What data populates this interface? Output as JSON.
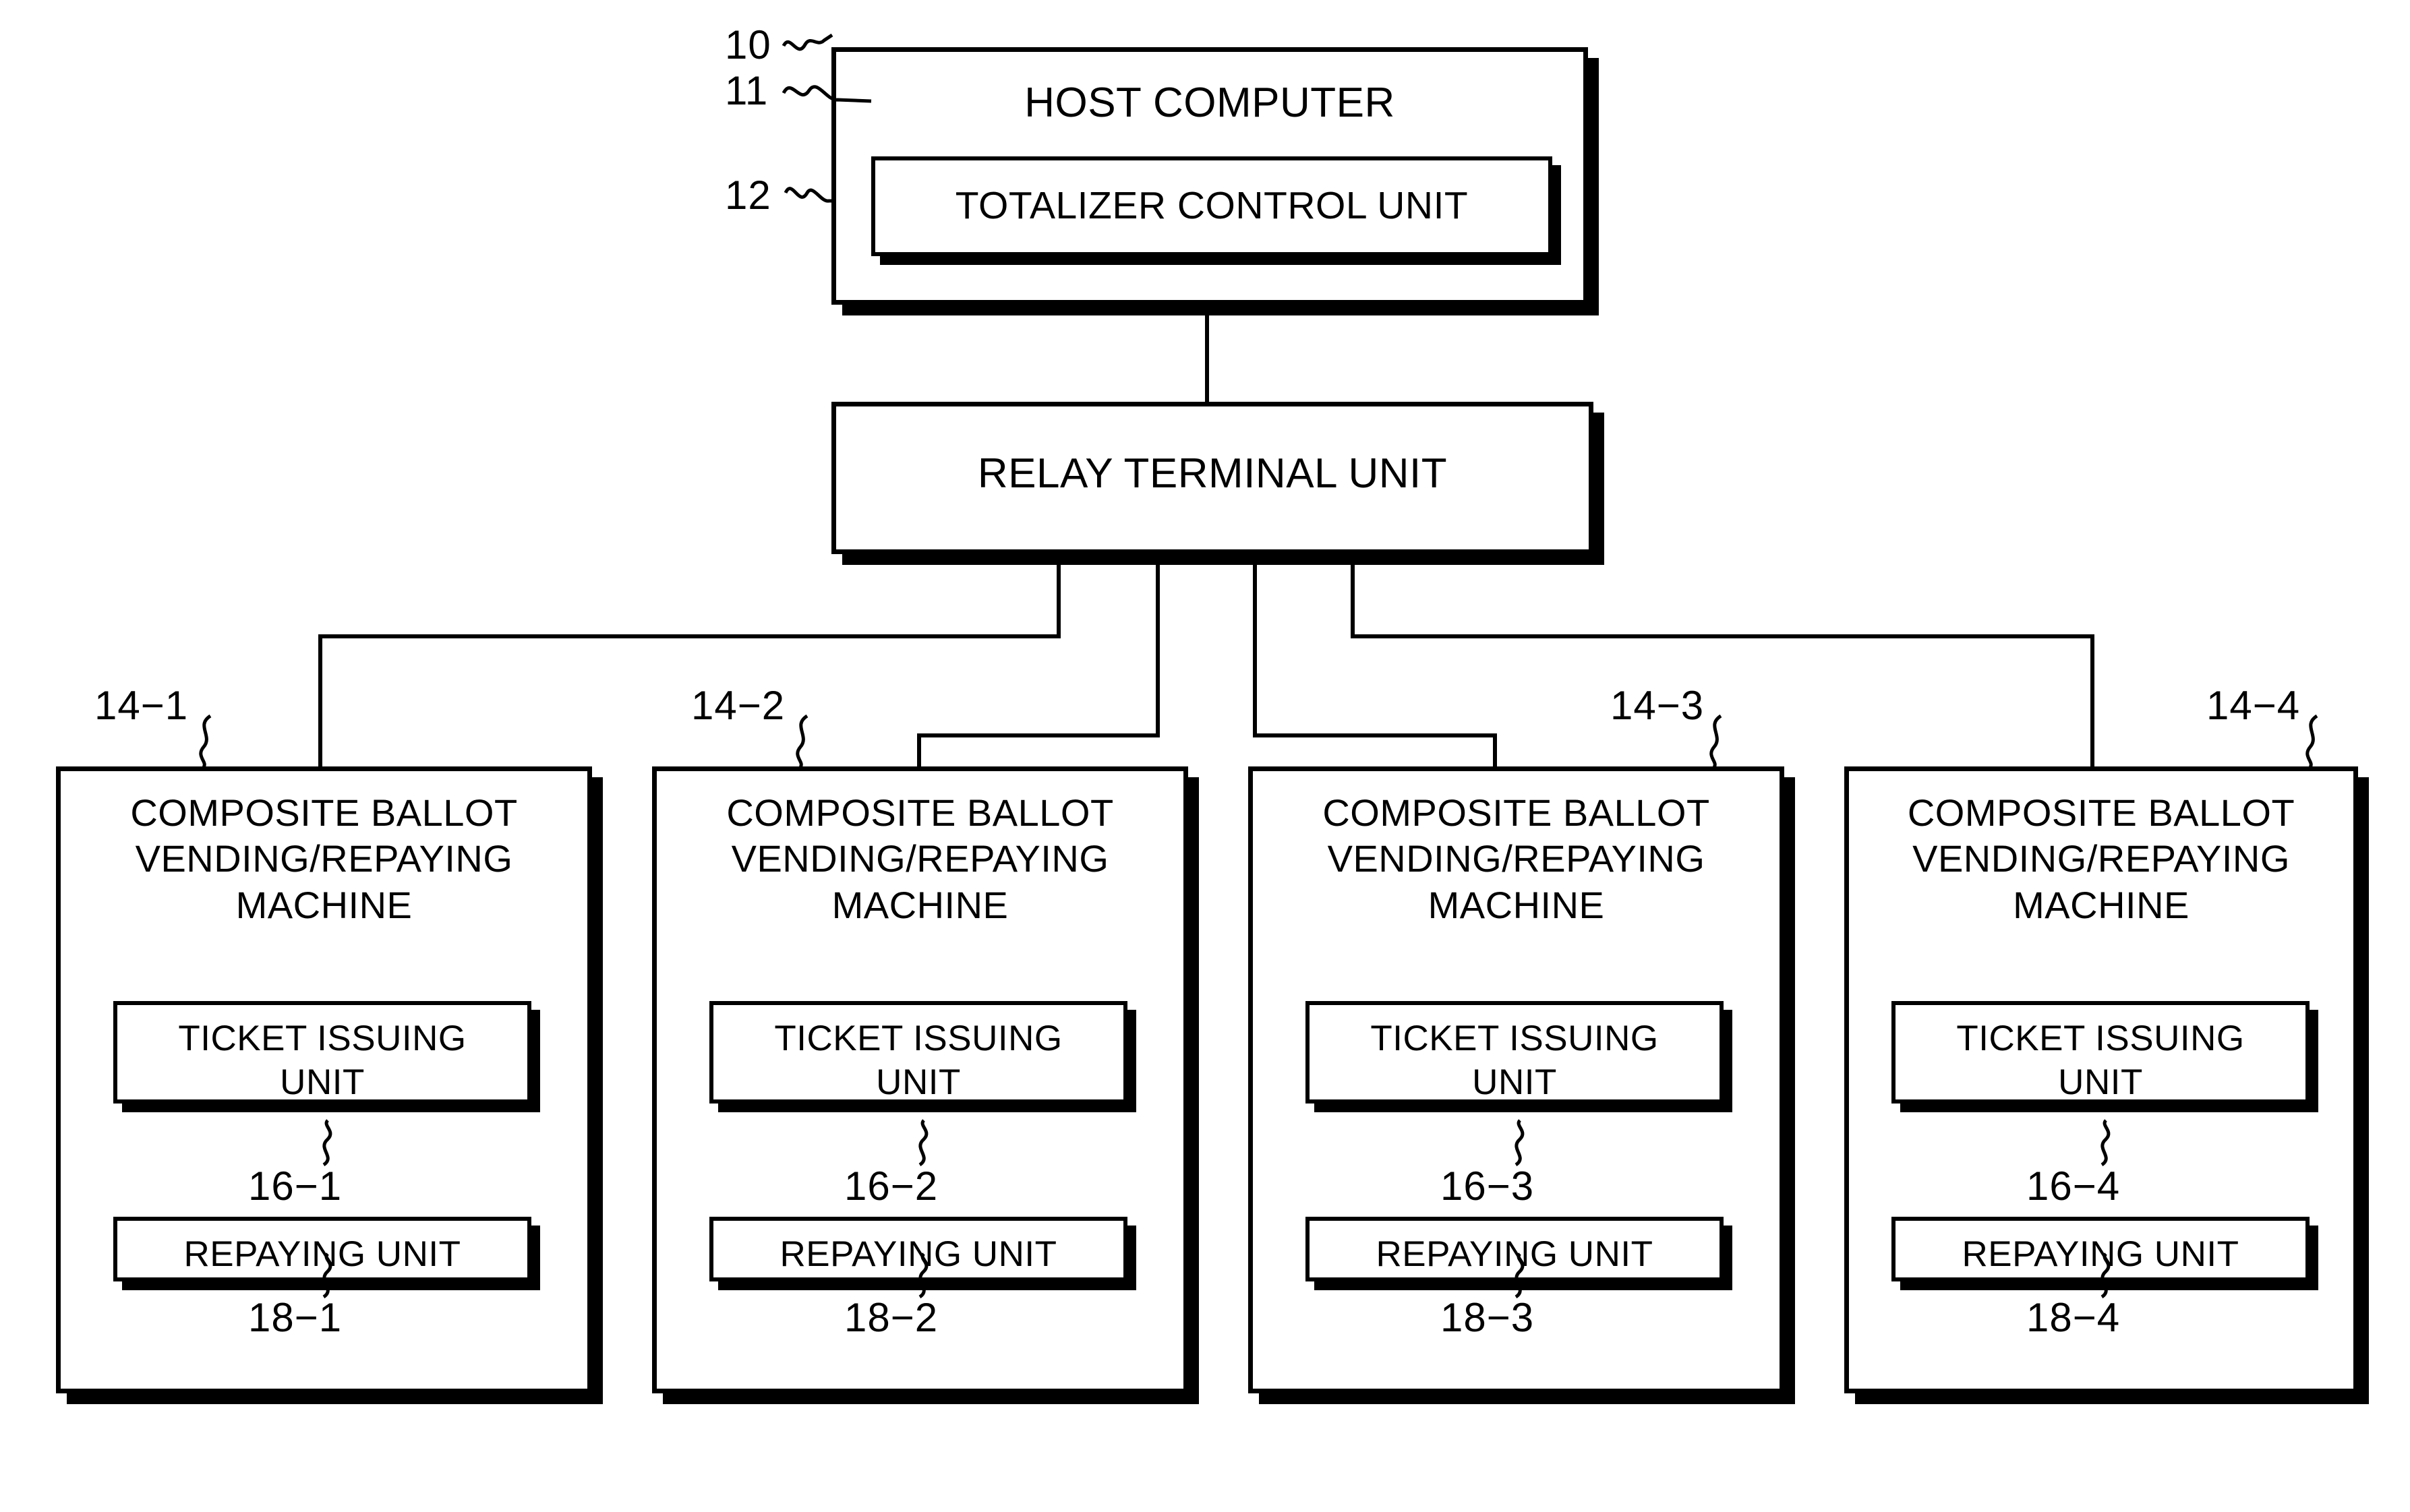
{
  "figure": {
    "title": "Composite ballot vending/repaying machine system block diagram",
    "line_color": "#000000",
    "background": "#ffffff"
  },
  "host": {
    "ref": "10",
    "label": "HOST COMPUTER",
    "inner": {
      "ref": "11",
      "label": "TOTALIZER CONTROL UNIT"
    }
  },
  "relay": {
    "ref": "12",
    "label": "RELAY TERMINAL UNIT"
  },
  "machines": [
    {
      "ref": "14−1",
      "label": "COMPOSITE BALLOT\nVENDING/REPAYING\nMACHINE",
      "ticket": {
        "label": "TICKET ISSUING\nUNIT",
        "ref": "16−1"
      },
      "repay": {
        "label": "REPAYING UNIT",
        "ref": "18−1"
      }
    },
    {
      "ref": "14−2",
      "label": "COMPOSITE BALLOT\nVENDING/REPAYING\nMACHINE",
      "ticket": {
        "label": "TICKET ISSUING\nUNIT",
        "ref": "16−2"
      },
      "repay": {
        "label": "REPAYING UNIT",
        "ref": "18−2"
      }
    },
    {
      "ref": "14−3",
      "label": "COMPOSITE BALLOT\nVENDING/REPAYING\nMACHINE",
      "ticket": {
        "label": "TICKET ISSUING\nUNIT",
        "ref": "16−3"
      },
      "repay": {
        "label": "REPAYING UNIT",
        "ref": "18−3"
      }
    },
    {
      "ref": "14−4",
      "label": "COMPOSITE BALLOT\nVENDING/REPAYING\nMACHINE",
      "ticket": {
        "label": "TICKET ISSUING\nUNIT",
        "ref": "16−4"
      },
      "repay": {
        "label": "REPAYING UNIT",
        "ref": "18−4"
      }
    }
  ]
}
